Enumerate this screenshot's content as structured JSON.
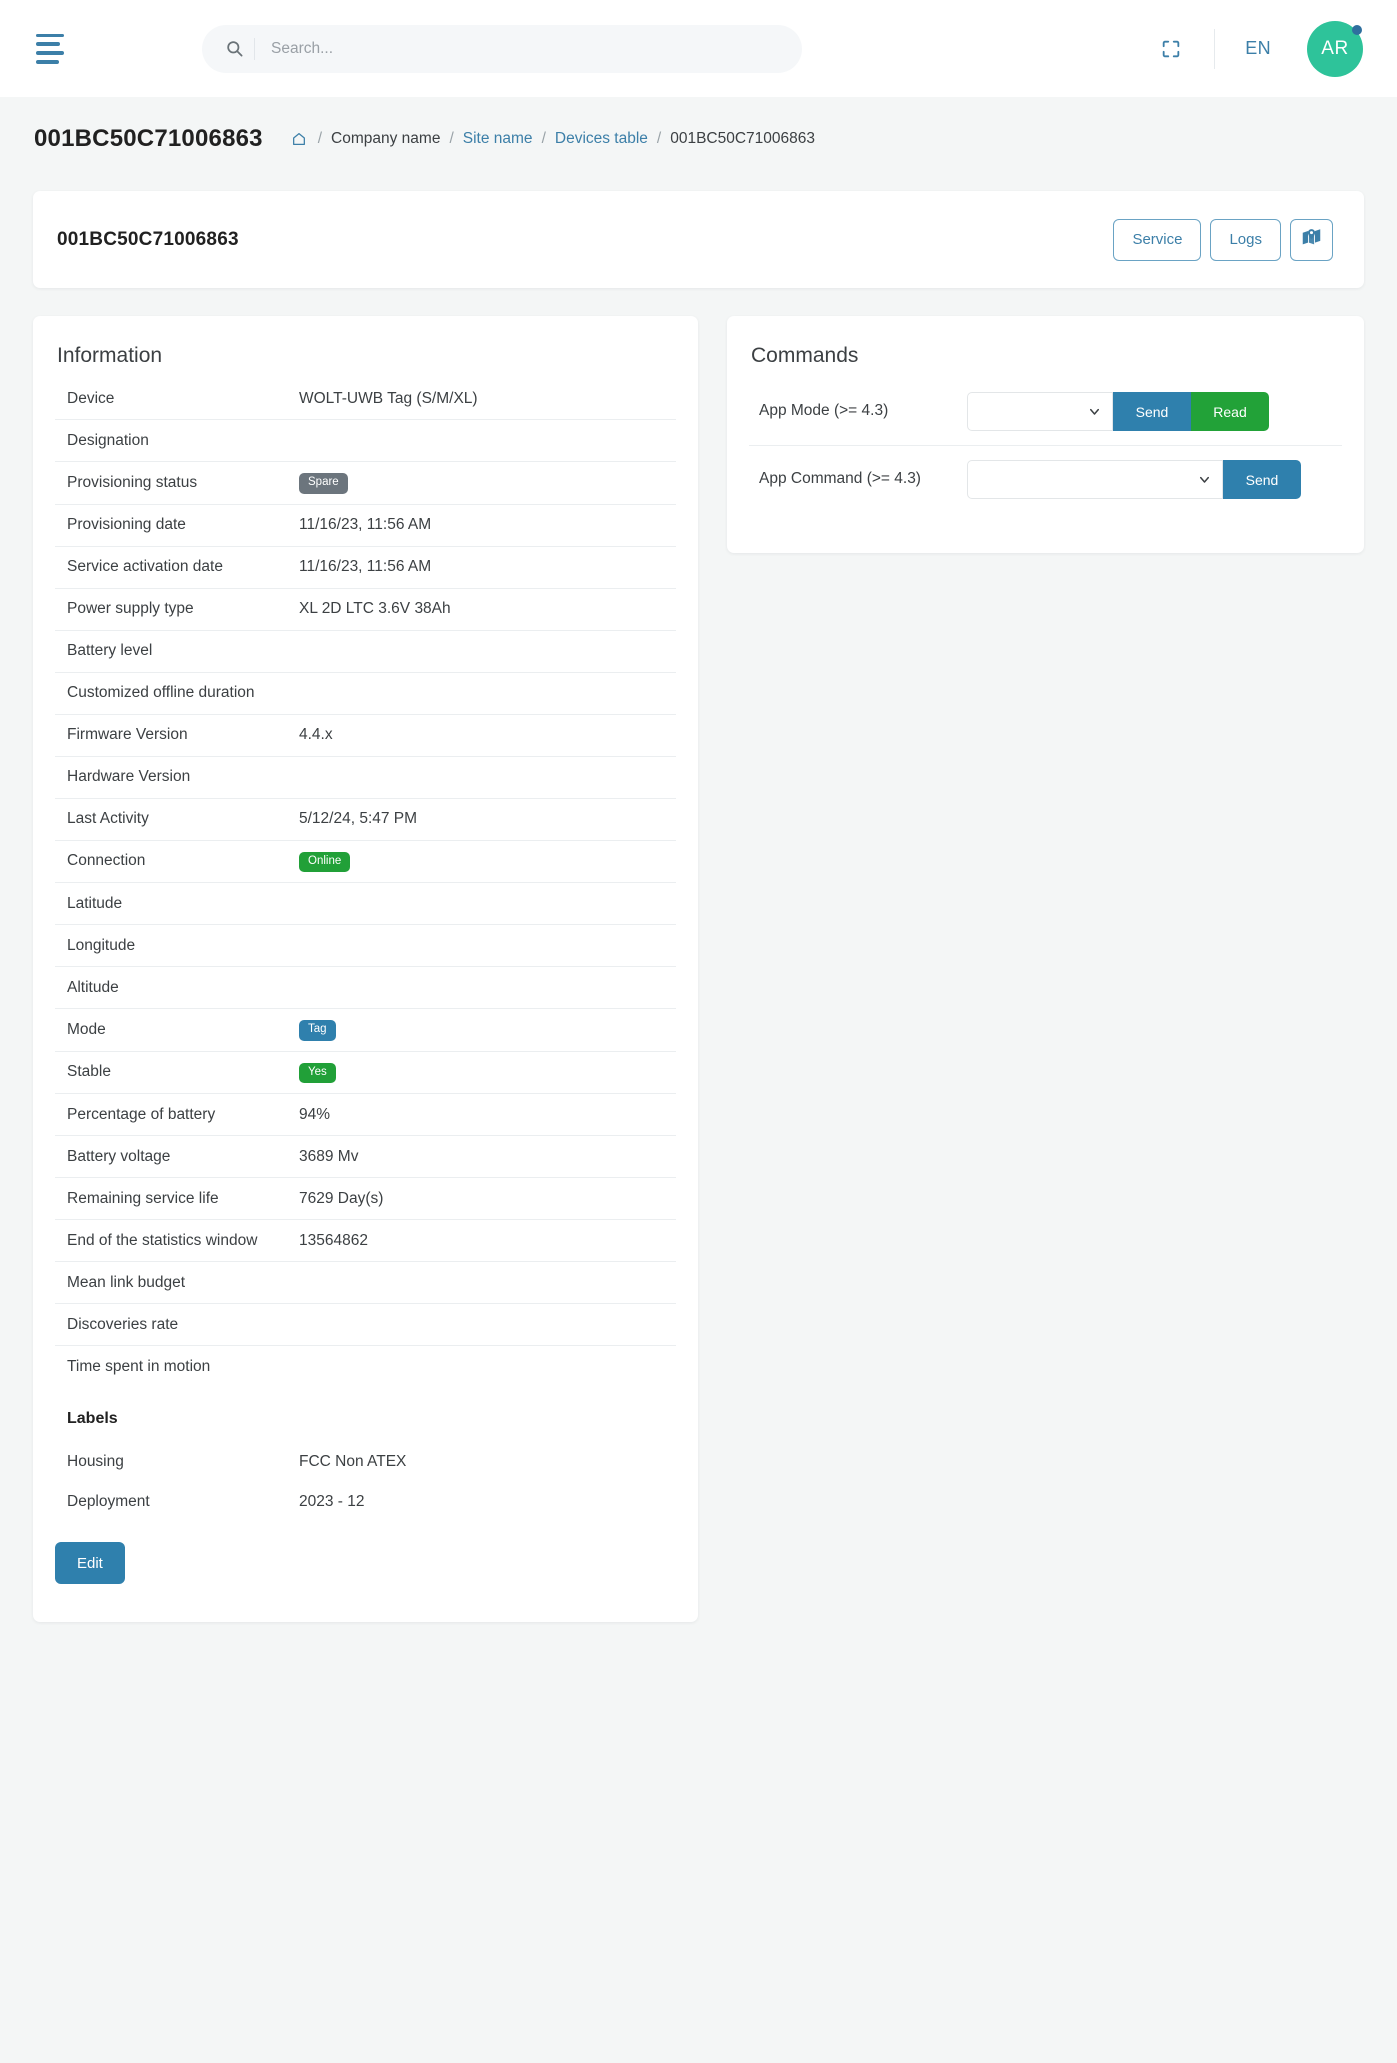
{
  "topbar": {
    "menu_icon": "hamburger-icon",
    "search": {
      "placeholder": "Search...",
      "value": "",
      "icon": "search-icon"
    },
    "fullscreen_icon": "fullscreen-icon",
    "language": "EN",
    "avatar_initials": "AR"
  },
  "header": {
    "page_title": "001BC50C71006863",
    "breadcrumb": {
      "home_icon": "home-icon",
      "separator": "/",
      "items": [
        {
          "label": "Company name",
          "link": false
        },
        {
          "label": "Site name",
          "link": true
        },
        {
          "label": "Devices table",
          "link": true
        },
        {
          "label": "001BC50C71006863",
          "link": false
        }
      ]
    }
  },
  "device_card": {
    "title": "001BC50C71006863",
    "actions": {
      "service_label": "Service",
      "logs_label": "Logs",
      "map_icon": "map-pin-icon"
    }
  },
  "information": {
    "title": "Information",
    "rows": [
      {
        "key": "Device",
        "value": "WOLT-UWB Tag (S/M/XL)",
        "type": "text"
      },
      {
        "key": "Designation",
        "value": "",
        "type": "text"
      },
      {
        "key": "Provisioning status",
        "value": "Spare",
        "type": "badge",
        "badge_color": "gray"
      },
      {
        "key": "Provisioning date",
        "value": "11/16/23, 11:56 AM",
        "type": "text"
      },
      {
        "key": "Service activation date",
        "value": "11/16/23, 11:56 AM",
        "type": "text"
      },
      {
        "key": "Power supply type",
        "value": "XL 2D LTC 3.6V 38Ah",
        "type": "text"
      },
      {
        "key": "Battery level",
        "value": "",
        "type": "text"
      },
      {
        "key": "Customized offline duration",
        "value": "",
        "type": "text"
      },
      {
        "key": "Firmware Version",
        "value": "4.4.x",
        "type": "text"
      },
      {
        "key": "Hardware Version",
        "value": "",
        "type": "text"
      },
      {
        "key": "Last Activity",
        "value": "5/12/24, 5:47 PM",
        "type": "text"
      },
      {
        "key": "Connection",
        "value": "Online",
        "type": "badge",
        "badge_color": "green"
      },
      {
        "key": "Latitude",
        "value": "",
        "type": "text"
      },
      {
        "key": "Longitude",
        "value": "",
        "type": "text"
      },
      {
        "key": "Altitude",
        "value": "",
        "type": "text"
      },
      {
        "key": "Mode",
        "value": "Tag",
        "type": "badge",
        "badge_color": "blue"
      },
      {
        "key": "Stable",
        "value": "Yes",
        "type": "badge",
        "badge_color": "green"
      },
      {
        "key": "Percentage of battery",
        "value": "94%",
        "type": "text"
      },
      {
        "key": "Battery voltage",
        "value": "3689 Mv",
        "type": "text"
      },
      {
        "key": "Remaining service life",
        "value": "7629 Day(s)",
        "type": "text"
      },
      {
        "key": "End of the statistics window",
        "value": "13564862",
        "type": "text"
      },
      {
        "key": "Mean link budget",
        "value": "",
        "type": "text"
      },
      {
        "key": "Discoveries rate",
        "value": "",
        "type": "text"
      },
      {
        "key": "Time spent in motion",
        "value": "",
        "type": "text"
      }
    ],
    "labels_title": "Labels",
    "labels": [
      {
        "key": "Housing",
        "value": "FCC Non ATEX"
      },
      {
        "key": "Deployment",
        "value": "2023 - 12"
      }
    ],
    "edit_label": "Edit"
  },
  "commands": {
    "title": "Commands",
    "rows": [
      {
        "key": "App Mode (>= 4.3)",
        "selected": "",
        "chevron_icon": "chevron-down-icon",
        "buttons": [
          {
            "label": "Send",
            "style": "send"
          },
          {
            "label": "Read",
            "style": "read"
          }
        ]
      },
      {
        "key": "App Command (>= 4.3)",
        "selected": "",
        "chevron_icon": "chevron-down-icon",
        "buttons": [
          {
            "label": "Send",
            "style": "send"
          }
        ]
      }
    ]
  },
  "colors": {
    "accent_blue": "#2f80ad",
    "link_blue": "#3c7fa8",
    "green": "#22a238",
    "gray_badge": "#6c757d",
    "avatar_teal": "#2ec39a",
    "page_bg": "#f4f6f6"
  }
}
